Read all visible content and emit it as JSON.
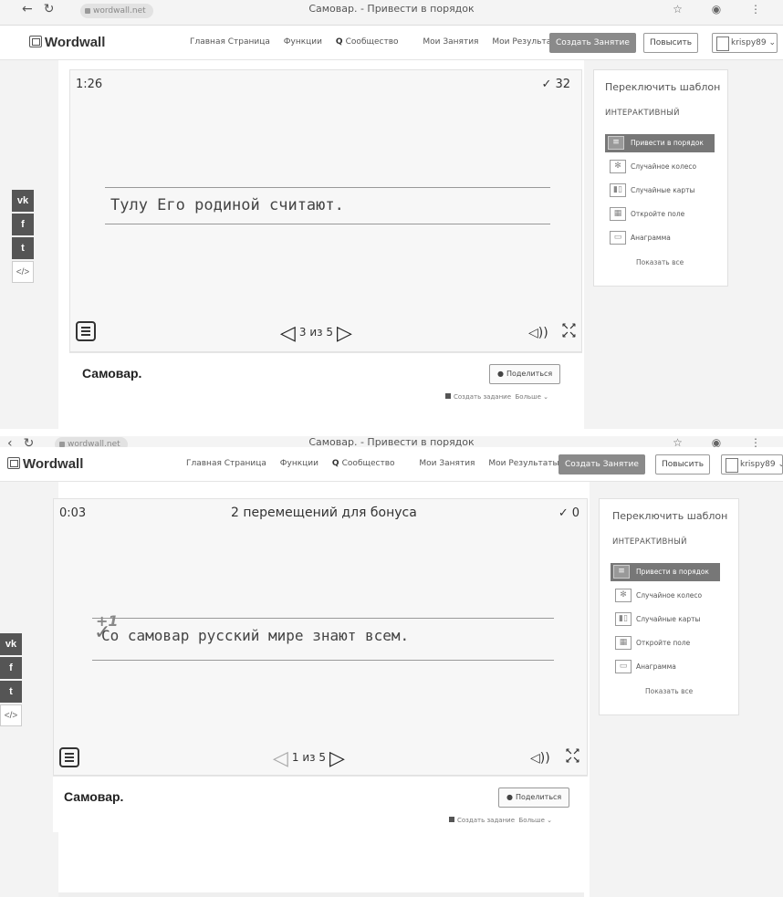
{
  "browser": {
    "url": "wordwall.net",
    "tab_title": "Самовар. - Привести в порядок",
    "right_icons": "☆ ◉ ⋮"
  },
  "navbar": {
    "logo": "Wordwall",
    "links": [
      "Главная Страница",
      "Функции",
      "Сообщество",
      "Мои Занятия",
      "Мои Результаты"
    ],
    "create_button": "Создать Занятие",
    "upgrade_button": "Повысить",
    "user_name": "krispy89",
    "user_chevron": "⌄"
  },
  "share_rail": {
    "vk": "vk",
    "facebook": "f",
    "twitter": "t",
    "embed": "</>"
  },
  "top_game": {
    "timer": "1:26",
    "score_check": "✓",
    "score": "32",
    "sentence": "Тулу Его родиной считают.",
    "pager_text": "3 из 5"
  },
  "bottom_game": {
    "timer": "0:03",
    "bonus_text": "2 перемещений для бонуса",
    "score_check": "✓",
    "score": "0",
    "plus_badge": "+1",
    "sentence": "Со самовар русский мире знают всем.",
    "pager_text": "1 из 5"
  },
  "activity": {
    "title": "Самовар.",
    "share_button": "Поделиться",
    "create_task_link": "Создать задание",
    "more_link": "Больше ⌄"
  },
  "template_panel": {
    "title": "Переключить шаблон",
    "subtitle": "ИНТЕРАКТИВНЫЙ",
    "items": [
      {
        "label": "Привести в порядок",
        "icon": "≡",
        "icon_name": "unjumble-icon"
      },
      {
        "label": "Случайное колесо",
        "icon": "✻",
        "icon_name": "wheel-icon"
      },
      {
        "label": "Случайные карты",
        "icon": "▮▯",
        "icon_name": "cards-icon"
      },
      {
        "label": "Откройте поле",
        "icon": "▦",
        "icon_name": "open-box-icon"
      },
      {
        "label": "Анаграмма",
        "icon": "▭",
        "icon_name": "anagram-icon"
      }
    ],
    "show_all": "Показать все"
  },
  "colors": {
    "accent_gray": "#8a8a8a",
    "panel_active": "#777777",
    "share_button_bg": "#555555"
  }
}
